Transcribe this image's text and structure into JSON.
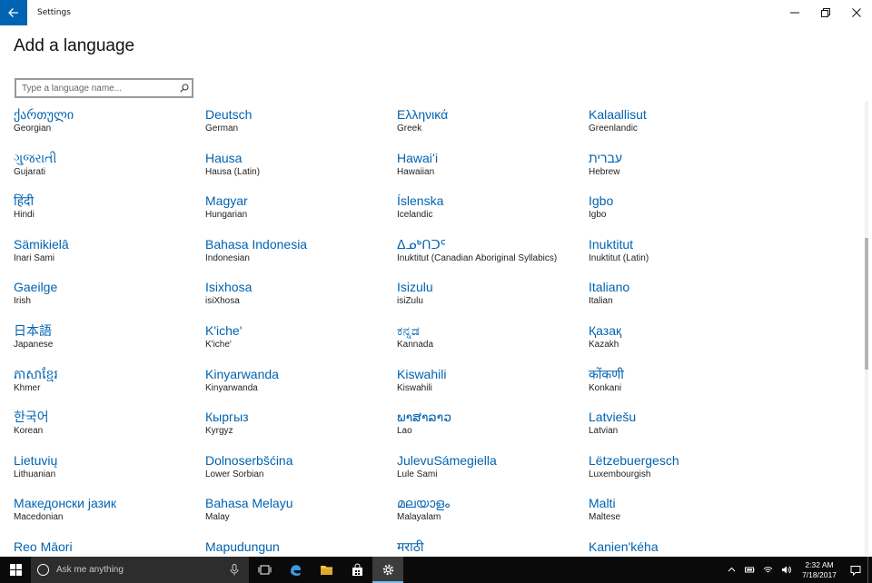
{
  "window": {
    "title": "Settings",
    "page_title": "Add a language"
  },
  "search": {
    "placeholder": "Type a language name...",
    "value": ""
  },
  "languages": [
    {
      "native": "ქართული",
      "english": "Georgian"
    },
    {
      "native": "Deutsch",
      "english": "German"
    },
    {
      "native": "Ελληνικά",
      "english": "Greek"
    },
    {
      "native": "Kalaallisut",
      "english": "Greenlandic"
    },
    {
      "native": "ગુજરાતી",
      "english": "Gujarati"
    },
    {
      "native": "Hausa",
      "english": "Hausa (Latin)"
    },
    {
      "native": "Hawaiʻi",
      "english": "Hawaiian"
    },
    {
      "native": "עברית",
      "english": "Hebrew"
    },
    {
      "native": "हिंदी",
      "english": "Hindi"
    },
    {
      "native": "Magyar",
      "english": "Hungarian"
    },
    {
      "native": "Íslenska",
      "english": "Icelandic"
    },
    {
      "native": "Igbo",
      "english": "Igbo"
    },
    {
      "native": "Sämikielâ",
      "english": "Inari Sami"
    },
    {
      "native": "Bahasa Indonesia",
      "english": "Indonesian"
    },
    {
      "native": "ᐃᓄᒃᑎᑐᑦ",
      "english": "Inuktitut (Canadian Aboriginal Syllabics)"
    },
    {
      "native": "Inuktitut",
      "english": "Inuktitut (Latin)"
    },
    {
      "native": "Gaeilge",
      "english": "Irish"
    },
    {
      "native": "Isixhosa",
      "english": "isiXhosa"
    },
    {
      "native": "Isizulu",
      "english": "isiZulu"
    },
    {
      "native": "Italiano",
      "english": "Italian"
    },
    {
      "native": "日本語",
      "english": "Japanese"
    },
    {
      "native": "K'iche'",
      "english": "K'iche'"
    },
    {
      "native": "ಕನ್ನಡ",
      "english": "Kannada"
    },
    {
      "native": "Қазақ",
      "english": "Kazakh"
    },
    {
      "native": "ភាសាខ្មែរ",
      "english": "Khmer"
    },
    {
      "native": "Kinyarwanda",
      "english": "Kinyarwanda"
    },
    {
      "native": "Kiswahili",
      "english": "Kiswahili"
    },
    {
      "native": "कोंकणी",
      "english": "Konkani"
    },
    {
      "native": "한국어",
      "english": "Korean"
    },
    {
      "native": "Кыргыз",
      "english": "Kyrgyz"
    },
    {
      "native": "ພາສາລາວ",
      "english": "Lao"
    },
    {
      "native": "Latviešu",
      "english": "Latvian"
    },
    {
      "native": "Lietuvių",
      "english": "Lithuanian"
    },
    {
      "native": "Dolnoserbšćina",
      "english": "Lower Sorbian"
    },
    {
      "native": "JulevuSámegiella",
      "english": "Lule Sami"
    },
    {
      "native": "Lëtzebuergesch",
      "english": "Luxembourgish"
    },
    {
      "native": "Македонски јазик",
      "english": "Macedonian"
    },
    {
      "native": "Bahasa Melayu",
      "english": "Malay"
    },
    {
      "native": "മലയാളം",
      "english": "Malayalam"
    },
    {
      "native": "Malti",
      "english": "Maltese"
    },
    {
      "native": "Reo Māori",
      "english": ""
    },
    {
      "native": "Mapudungun",
      "english": ""
    },
    {
      "native": "मराठी",
      "english": ""
    },
    {
      "native": "Kanien'kéha",
      "english": ""
    }
  ],
  "taskbar": {
    "search_placeholder": "Ask me anything",
    "time": "2:32 AM",
    "date": "7/18/2017"
  },
  "colors": {
    "accent": "#0063b1",
    "taskbar": "#0a0a0a",
    "search_box": "#2d2d2d"
  }
}
